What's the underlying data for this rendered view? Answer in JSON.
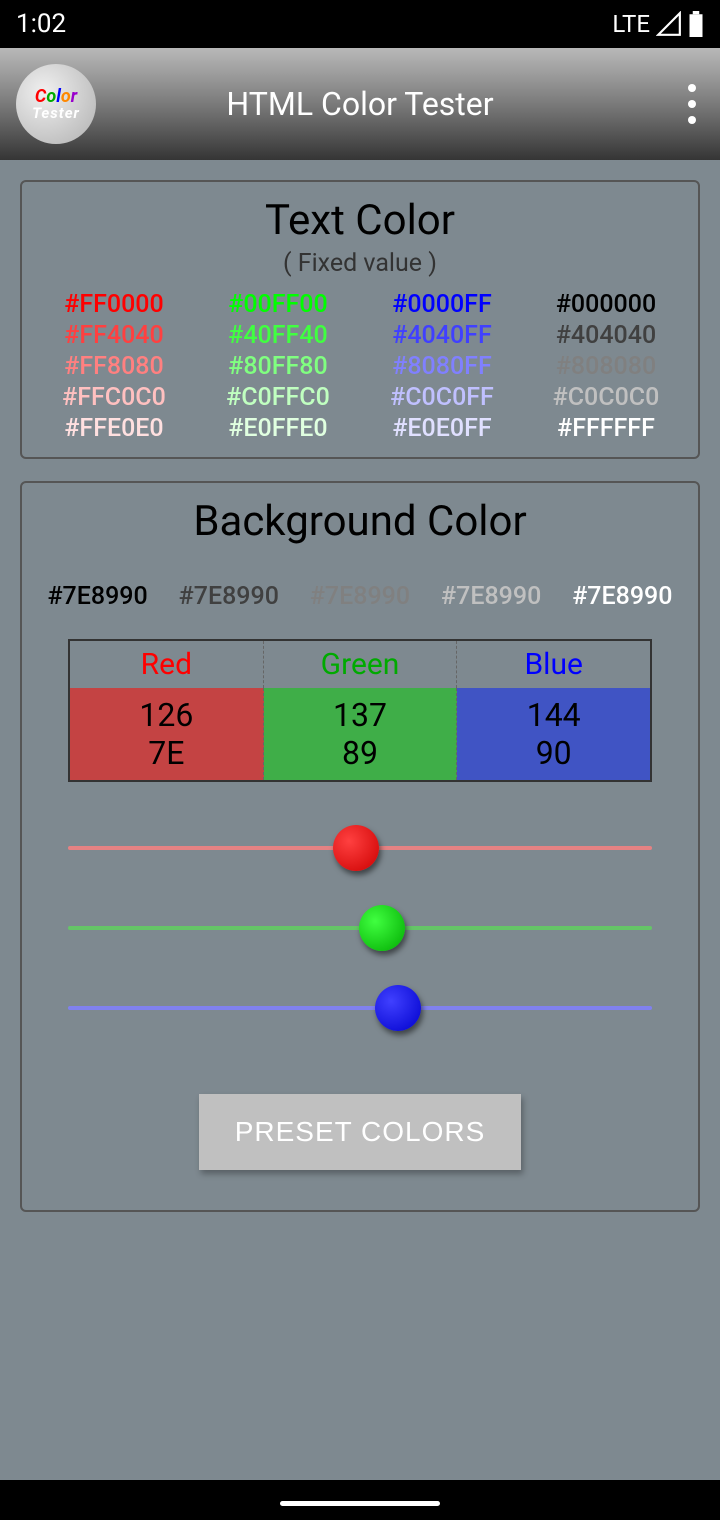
{
  "status": {
    "time": "1:02",
    "network": "LTE"
  },
  "header": {
    "title": "HTML Color Tester",
    "logo_word1": "Color",
    "logo_word2": "Tester"
  },
  "text_color_panel": {
    "title": "Text Color",
    "subtitle": "( Fixed value )",
    "grid": [
      [
        {
          "label": "#FF0000",
          "color": "#FF0000"
        },
        {
          "label": "#00FF00",
          "color": "#00FF00"
        },
        {
          "label": "#0000FF",
          "color": "#0000FF"
        },
        {
          "label": "#000000",
          "color": "#000000"
        }
      ],
      [
        {
          "label": "#FF4040",
          "color": "#FF4040"
        },
        {
          "label": "#40FF40",
          "color": "#40FF40"
        },
        {
          "label": "#4040FF",
          "color": "#4040FF"
        },
        {
          "label": "#404040",
          "color": "#404040"
        }
      ],
      [
        {
          "label": "#FF8080",
          "color": "#FF8080"
        },
        {
          "label": "#80FF80",
          "color": "#80FF80"
        },
        {
          "label": "#8080FF",
          "color": "#8080FF"
        },
        {
          "label": "#808080",
          "color": "#808080"
        }
      ],
      [
        {
          "label": "#FFC0C0",
          "color": "#FFC0C0"
        },
        {
          "label": "#C0FFC0",
          "color": "#C0FFC0"
        },
        {
          "label": "#C0C0FF",
          "color": "#C0C0FF"
        },
        {
          "label": "#C0C0C0",
          "color": "#C0C0C0"
        }
      ],
      [
        {
          "label": "#FFE0E0",
          "color": "#FFE0E0"
        },
        {
          "label": "#E0FFE0",
          "color": "#E0FFE0"
        },
        {
          "label": "#E0E0FF",
          "color": "#E0E0FF"
        },
        {
          "label": "#FFFFFF",
          "color": "#FFFFFF"
        }
      ]
    ]
  },
  "background_panel": {
    "title": "Background Color",
    "hex_samples": [
      {
        "label": "#7E8990",
        "color": "#000000"
      },
      {
        "label": "#7E8990",
        "color": "#404040"
      },
      {
        "label": "#7E8990",
        "color": "#808080"
      },
      {
        "label": "#7E8990",
        "color": "#C0C0C0"
      },
      {
        "label": "#7E8990",
        "color": "#FFFFFF"
      }
    ],
    "rgb": {
      "labels": {
        "r": "Red",
        "g": "Green",
        "b": "Blue"
      },
      "red": {
        "dec": "126",
        "hex": "7E",
        "pct": 49.4
      },
      "green": {
        "dec": "137",
        "hex": "89",
        "pct": 53.7
      },
      "blue": {
        "dec": "144",
        "hex": "90",
        "pct": 56.5
      }
    },
    "preset_button": "PRESET COLORS"
  }
}
